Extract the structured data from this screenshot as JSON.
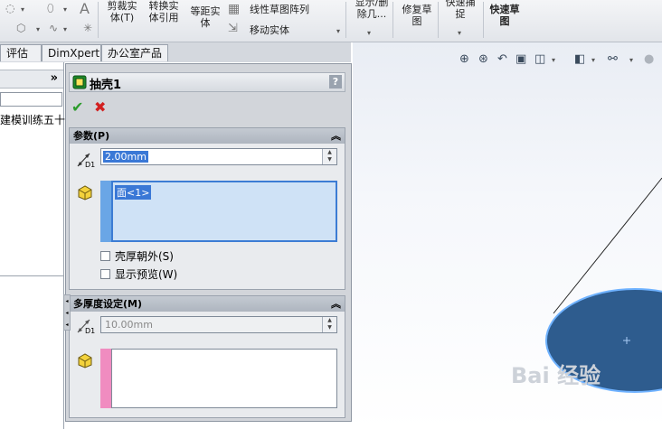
{
  "ribbon": {
    "trim_label": "剪裁实\n体(T)",
    "convert_label": "转换实\n体引用",
    "offset_label": "等距实\n体",
    "linear_pattern_label": "线性草图阵列",
    "move_entities_label": "移动实体",
    "display_delete_label": "显示/删\n除几...",
    "repair_sketch_label": "修复草\n图",
    "quick_snap_label": "快速捕\n捉",
    "rapid_sketch_label": "快速草\n图"
  },
  "tabs": [
    {
      "label": "评估"
    },
    {
      "label": "DimXpert"
    },
    {
      "label": "办公室产品"
    }
  ],
  "tree": {
    "expand": "»",
    "item": "建模训练五十之"
  },
  "property_manager": {
    "title": "抽壳1",
    "help": "?",
    "ok": "✔",
    "cancel": "✖",
    "parameters": {
      "header": "参数(P)",
      "collapse": "︽",
      "dim_tag": "D1",
      "thickness": "2.00mm",
      "faces": [
        "面<1>"
      ],
      "shell_outward": "壳厚朝外(S)",
      "show_preview": "显示预览(W)"
    },
    "multi_thickness": {
      "header": "多厚度设定(M)",
      "collapse": "︽",
      "dim_tag": "D1",
      "thickness": "10.00mm",
      "faces": []
    }
  },
  "colors": {
    "face_selected_bar": "#6aa6e6",
    "face_multi_bar": "#f08cc0",
    "model_fill": "#2e5c8e",
    "model_edge": "#6fb2ff",
    "confirm": "#2c9c2c",
    "cancel": "#d22020"
  },
  "watermark": "Bai 经验"
}
